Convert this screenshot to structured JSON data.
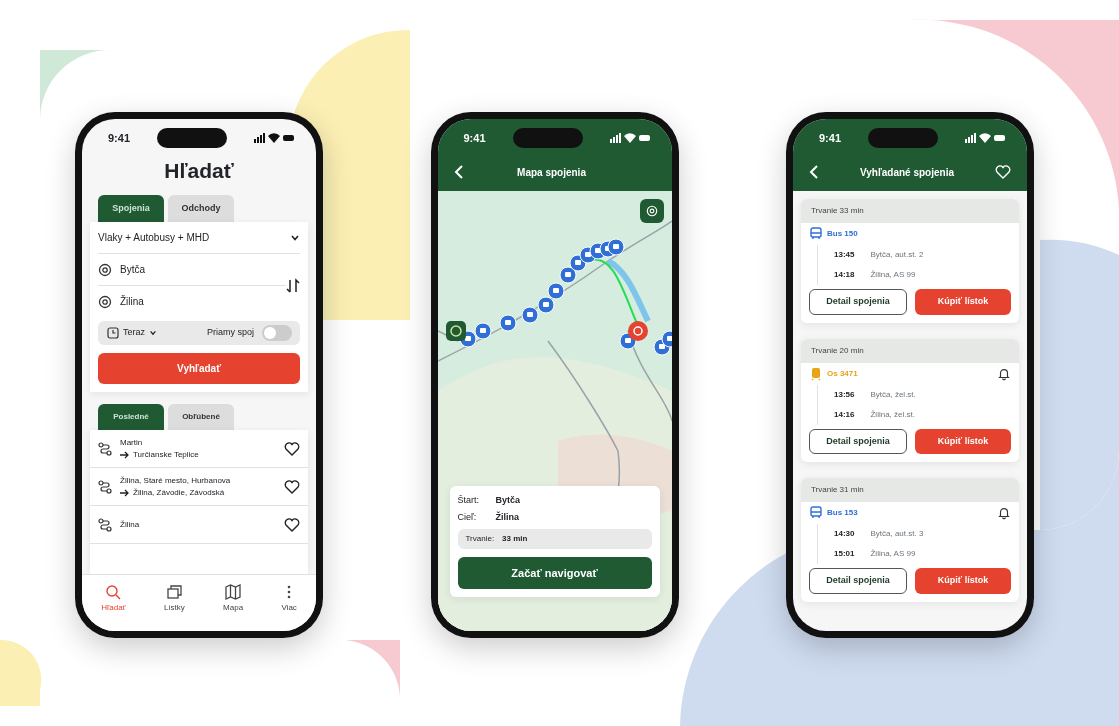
{
  "search_screen": {
    "status_time": "9:41",
    "title": "Hľadať",
    "tabs": [
      {
        "label": "Spojenia",
        "selected": true
      },
      {
        "label": "Odchody",
        "selected": false
      }
    ],
    "transport": "Vlaky + Autobusy + MHD",
    "from": "Bytča",
    "to": "Žilina",
    "time": "Teraz",
    "direct_label": "Priamy spoj",
    "direct_on": false,
    "search_button": "Vyhľadať",
    "list_tabs": [
      {
        "label": "Posledné",
        "selected": true
      },
      {
        "label": "Obľúbené",
        "selected": false
      }
    ],
    "recent": [
      {
        "from": "Martin",
        "to": "Turčianske Teplice"
      },
      {
        "from": "Žilina, Staré mesto, Hurbanova",
        "to": "Žilina, Závodie, Závodská"
      },
      {
        "from": "Žilina"
      }
    ],
    "nav": [
      {
        "label": "Hľadať",
        "selected": true
      },
      {
        "label": "Lístky",
        "selected": false
      },
      {
        "label": "Mapa",
        "selected": false
      },
      {
        "label": "Viac",
        "selected": false
      }
    ]
  },
  "map_screen": {
    "status_time": "9:41",
    "title": "Mapa spojenia",
    "start_label": "Štart:",
    "start": "Bytča",
    "end_label": "Cieľ:",
    "end": "Žilina",
    "duration_label": "Trvanie:",
    "duration": "33 min",
    "button": "Začať navigovať"
  },
  "results_screen": {
    "status_time": "9:41",
    "title": "Vyhľadané spojenia",
    "connections": [
      {
        "duration": "Trvanie 33 min",
        "line": "Bus 150",
        "kind": "bus",
        "color": "#2f6fd6",
        "notify": false,
        "stops": [
          {
            "time": "13:45",
            "place": "Bytča, aut.st. 2"
          },
          {
            "time": "14:18",
            "place": "Žilina, AS 99"
          }
        ],
        "detail_button": "Detail spojenia",
        "buy_button": "Kúpiť lístok"
      },
      {
        "duration": "Trvanie 20 min",
        "line": "Os 3471",
        "kind": "train",
        "color": "#e8a317",
        "notify": true,
        "stops": [
          {
            "time": "13:56",
            "place": "Bytča, žel.st."
          },
          {
            "time": "14:16",
            "place": "Žilina, žel.st."
          }
        ],
        "detail_button": "Detail spojenia",
        "buy_button": "Kúpiť lístok"
      },
      {
        "duration": "Trvanie 31 min",
        "line": "Bus 153",
        "kind": "bus",
        "color": "#2f6fd6",
        "notify": true,
        "stops": [
          {
            "time": "14:30",
            "place": "Bytča, aut.st. 3"
          },
          {
            "time": "15:01",
            "place": "Žilina, AS 99"
          }
        ],
        "detail_button": "Detail spojenia",
        "buy_button": "Kúpiť lístok"
      }
    ]
  }
}
